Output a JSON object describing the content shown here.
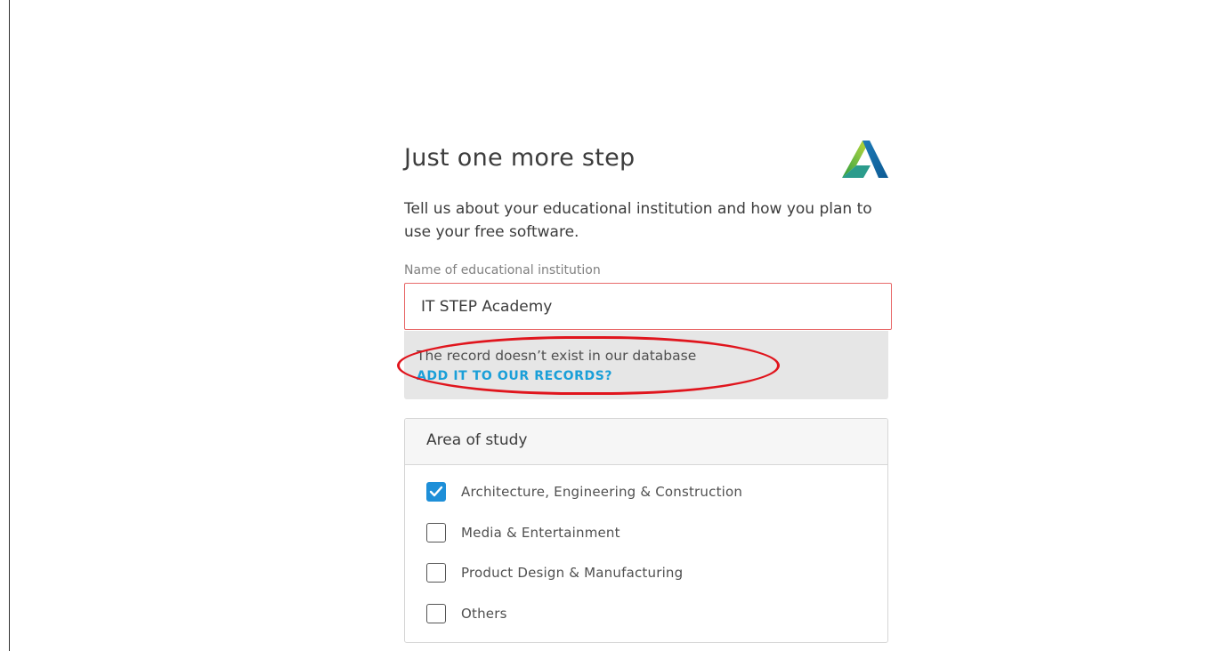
{
  "header": {
    "title": "Just one more step",
    "logo_icon": "autodesk-logo-icon"
  },
  "intro": {
    "text": "Tell us about your educational institution and how you plan to use your free software."
  },
  "institution_field": {
    "label": "Name of educational institution",
    "value": "IT STEP Academy",
    "border_color": "#e86a6a"
  },
  "notice": {
    "message": "The record doesn’t exist in our database",
    "link_label": "ADD IT TO OUR RECORDS?",
    "link_color": "#1a9fd8",
    "highlight_color": "#e0151d"
  },
  "area_of_study": {
    "title": "Area of study",
    "options": [
      {
        "label": "Architecture, Engineering & Construction",
        "checked": true
      },
      {
        "label": "Media & Entertainment",
        "checked": false
      },
      {
        "label": "Product Design & Manufacturing",
        "checked": false
      },
      {
        "label": "Others",
        "checked": false
      }
    ],
    "check_color": "#1e8fd8"
  }
}
